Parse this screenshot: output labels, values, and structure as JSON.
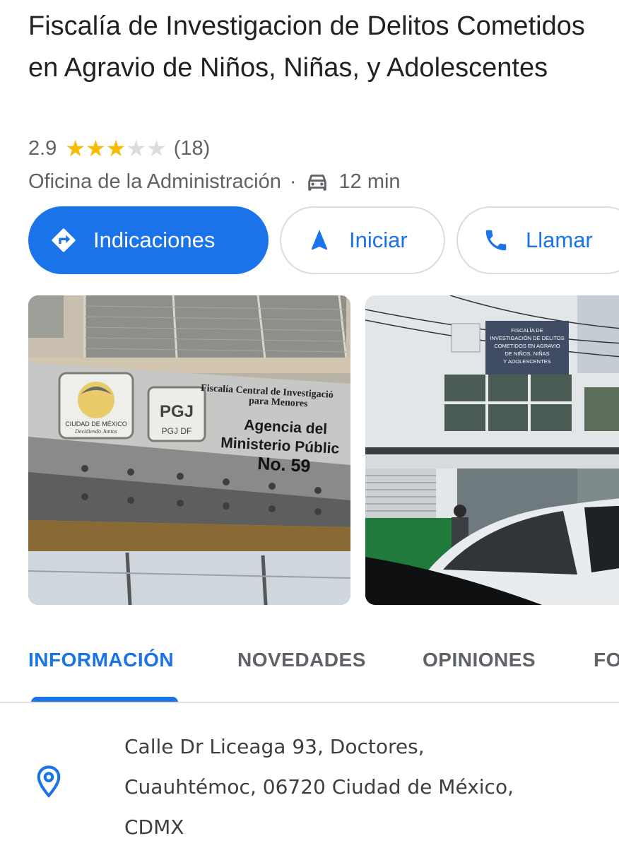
{
  "place": {
    "name": "Fiscalía de Investigacion de Delitos Cometidos en Agravio de Niños, Niñas, y Adolescentes",
    "rating": "2.9",
    "rating_value": 2.9,
    "rating_max": 5,
    "reviews_count": "(18)",
    "category": "Oficina de la Administración",
    "separator": "·",
    "travel_time": "12 min",
    "travel_mode_icon": "car-icon"
  },
  "actions": {
    "directions_label": "Indicaciones",
    "start_label": "Iniciar",
    "call_label": "Llamar"
  },
  "photos": {
    "photo1": {
      "sign_header_line1": "Fiscalía Central de Investigació",
      "sign_header_line2": "para Menores",
      "sign_line1": "Agencia del",
      "sign_line2": "Ministerio Públic",
      "sign_line3": "No. 59",
      "logo_cdmx_text": "CIUDAD DE MÉXICO",
      "logo_cdmx_subtext": "Decidiendo Juntos",
      "logo_pgj_text": "PGJ",
      "logo_pgj_subtext": "PGJ DF"
    },
    "photo2": {
      "sign_lines": [
        "FISCALÍA DE",
        "INVESTIGACIÓN DE DELITOS",
        "COMETIDOS EN AGRAVIO",
        "DE NIÑOS, NIÑAS",
        "Y ADOLESCENTES"
      ]
    }
  },
  "tabs": [
    {
      "label": "INFORMACIÓN",
      "active": true
    },
    {
      "label": "NOVEDADES",
      "active": false
    },
    {
      "label": "OPINIONES",
      "active": false
    },
    {
      "label": "FO",
      "active": false
    }
  ],
  "address": {
    "line1": "Calle Dr Liceaga 93, Doctores,",
    "line2": "Cuauhtémoc, 06720 Ciudad de México,",
    "line3": "CDMX",
    "icon": "location-pin-icon"
  },
  "colors": {
    "accent": "#1a73e8",
    "star": "#f9bb00",
    "star_empty": "#dadce0",
    "text_primary": "#202124",
    "text_secondary": "#5f6368"
  }
}
